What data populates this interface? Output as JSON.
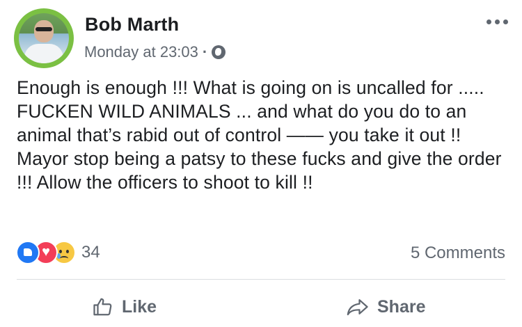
{
  "post": {
    "author": "Bob Marth",
    "timestamp": "Monday at 23:03",
    "separator": "·",
    "privacy_icon": "globe-icon",
    "text": "Enough is enough !!! What is going on is uncalled for ..... FUCKEN WILD ANIMALS ... and what do you do to an animal that’s rabid out of control —— you take it out !!  Mayor stop being a patsy to these fucks and give the order !!! Allow the officers to shoot to kill !!"
  },
  "reactions": {
    "types": [
      "like",
      "love",
      "sad"
    ],
    "count": "34"
  },
  "comments_label": "5 Comments",
  "actions": {
    "like_label": "Like",
    "share_label": "Share"
  },
  "colors": {
    "like_blue": "#2078f4",
    "love_red": "#f33e58",
    "sad_yellow": "#f7c843",
    "avatar_ring": "#7bc043",
    "secondary_text": "#606770"
  }
}
